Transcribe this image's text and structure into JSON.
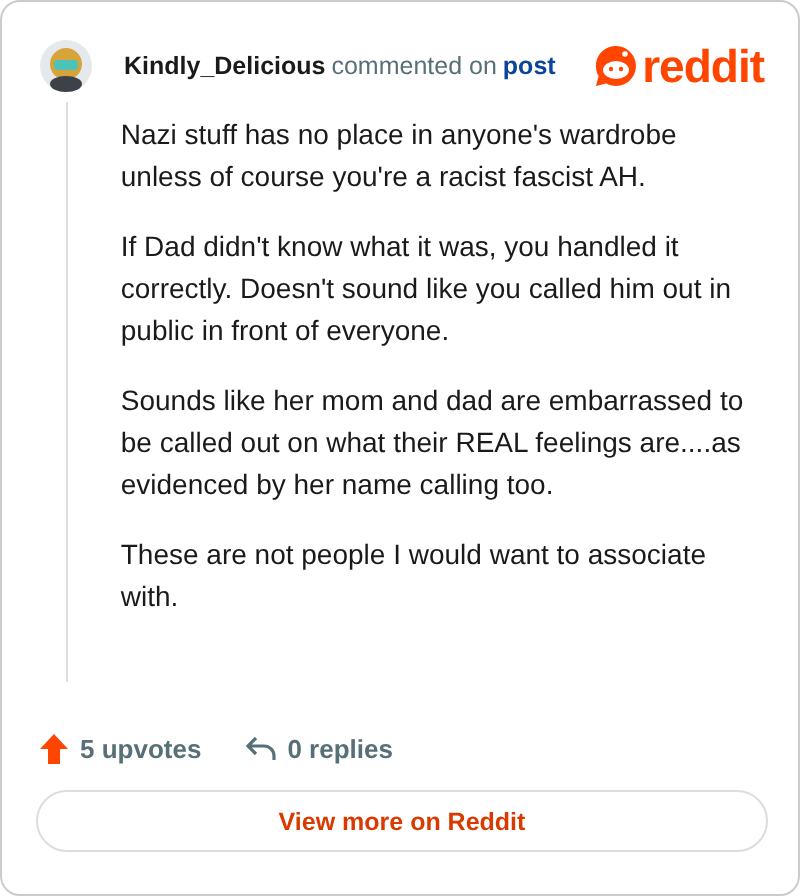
{
  "comment": {
    "author": "Kindly_Delicious",
    "action": "commented on",
    "link": "post",
    "brand": "reddit",
    "paragraphs": [
      "Nazi stuff has no place in anyone's wardrobe unless of course you're a racist fascist AH.",
      "If Dad didn't know what it was, you handled it correctly. Doesn't sound like you called him out in public in front of everyone.",
      "Sounds like her mom and dad are embarrassed to be called out on what their REAL feelings are....as evidenced by her name calling too.",
      "These are not people I would want to associate with."
    ]
  },
  "footer": {
    "upvotes": "5 upvotes",
    "replies": "0 replies"
  },
  "button": "View more on Reddit"
}
